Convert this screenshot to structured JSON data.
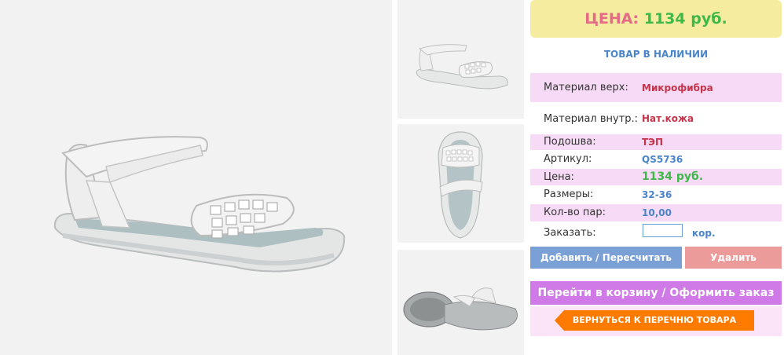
{
  "product": {
    "images": [
      {
        "icon": "sandal-side-image"
      },
      {
        "icon": "sandal-thumb-side"
      },
      {
        "icon": "sandal-thumb-top"
      },
      {
        "icon": "sandal-thumb-sole"
      }
    ]
  },
  "price_box": {
    "label": "ЦЕНА:",
    "value": "1134 руб."
  },
  "stock_status": "ТОВАР В НАЛИЧИИ",
  "specs": [
    {
      "label": "Материал верх:",
      "value": "Микрофибра"
    },
    {
      "label": "Материал внутр.:",
      "value": "Нат.кожа"
    },
    {
      "label": "Подошва:",
      "value": "ТЭП"
    },
    {
      "label": "Артикул:",
      "value": "QS5736"
    },
    {
      "label": "Цена:",
      "value": "1134 руб."
    },
    {
      "label": "Размеры:",
      "value": "32-36"
    },
    {
      "label": "Кол-во пар:",
      "value": "10,00"
    }
  ],
  "order": {
    "label": "Заказать:",
    "value": "",
    "unit": "кор."
  },
  "buttons": {
    "add": "Добавить / Пересчитать",
    "delete": "Удалить",
    "cart": "Перейти в корзину / Оформить заказ",
    "back": "ВЕРНУТЬСЯ К ПЕРЕЧНЮ ТОВАРА"
  },
  "colors": {
    "price_label": "#e46a86",
    "price_value": "#3fb84a",
    "accent_blue": "#4a84c9",
    "accent_red": "#c5344a",
    "cart_button": "#cf7ae6",
    "back_button": "#ff7b00"
  }
}
